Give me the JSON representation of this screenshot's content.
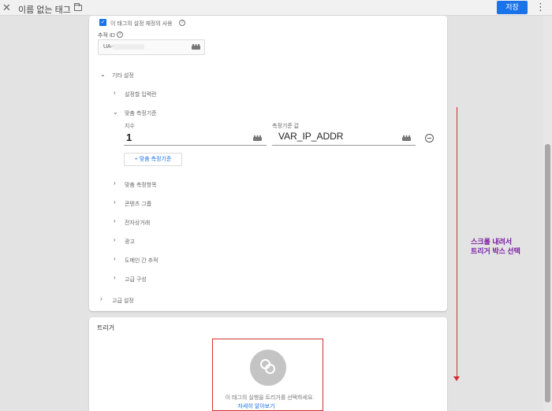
{
  "header": {
    "close_icon": "close-icon",
    "title": "이름 없는 태그",
    "folder_icon": "folder-icon",
    "save_label": "저장",
    "more_icon": "more-vert-icon",
    "colors": {
      "primary": "#1a73e8"
    }
  },
  "tag_config": {
    "use_settings_variable_label": "이 태그의 설정 재정의 사용",
    "tracking_id_label": "추적 ID",
    "tracking_id_value": "UA-",
    "more_settings_label": "기타 설정",
    "fields_to_set_label": "설정할 입력란",
    "custom_dimensions_label": "맞춤 측정기준",
    "index_label": "지수",
    "index_value": "1",
    "dimension_value_label": "측정기준 값",
    "dimension_value": "VAR_IP_ADDR",
    "add_dimension_label": "+ 맞춤 측정기준",
    "collapsed_sections": [
      {
        "label": "맞춤 측정항목"
      },
      {
        "label": "콘텐츠 그룹"
      },
      {
        "label": "전자상거래"
      },
      {
        "label": "광고"
      },
      {
        "label": "도메인 간 추적"
      },
      {
        "label": "고급 구성"
      }
    ],
    "advanced_settings_label": "고급 설정"
  },
  "trigger": {
    "title": "트리거",
    "empty_text": "이 태그의 실행을 트리거를 선택하세요.",
    "learn_more": "자세히 알아보기"
  },
  "annotation": {
    "line1": "스크롤 내려서",
    "line2": "트리거 박스 선택",
    "color": "#7b1fa2",
    "highlight_color": "#d32f2f"
  }
}
